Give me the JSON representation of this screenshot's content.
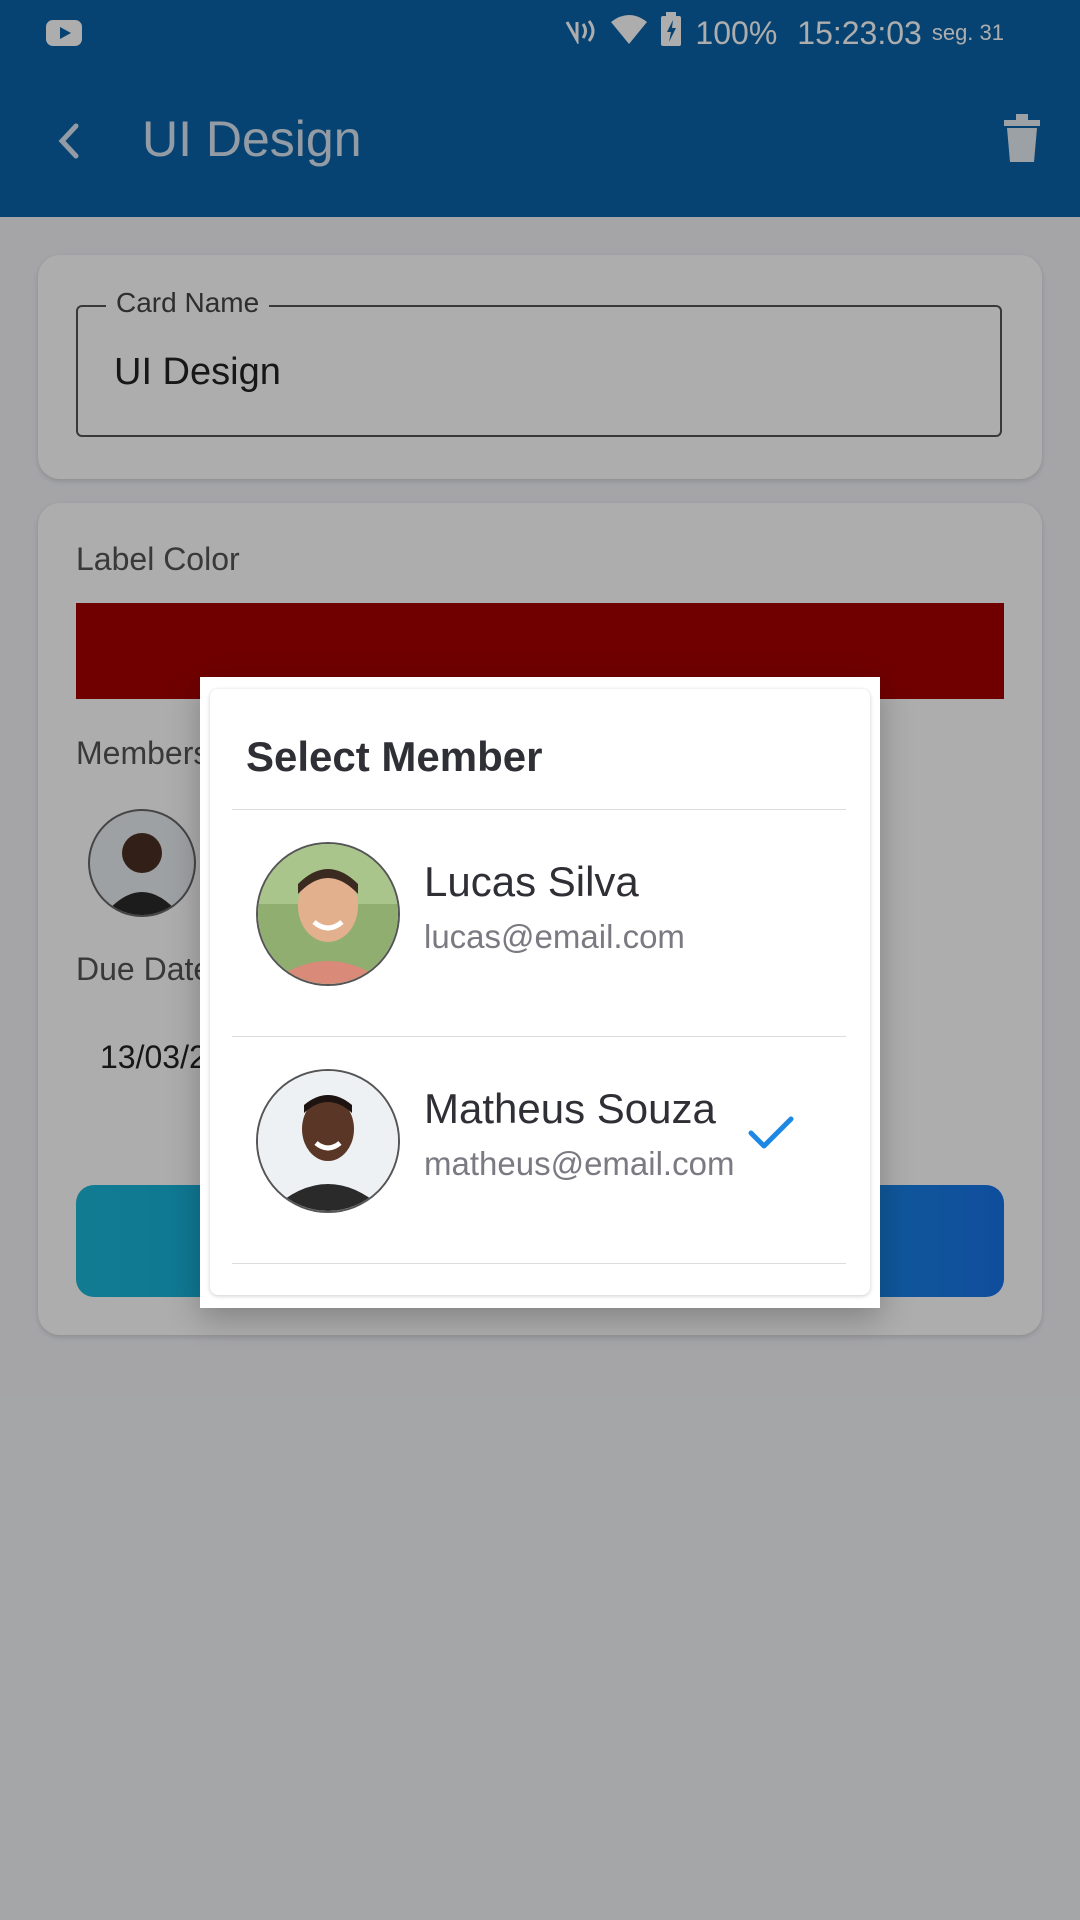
{
  "status_bar": {
    "battery": "100%",
    "time": "15:23:03",
    "date": "seg. 31"
  },
  "app_bar": {
    "title": "UI Design"
  },
  "card_name": {
    "label": "Card Name",
    "value": "UI Design"
  },
  "label_color": {
    "label": "Label Color",
    "color": "#a50000"
  },
  "members": {
    "label": "Members"
  },
  "due_date": {
    "label": "Due Date",
    "value": "13/03/2"
  },
  "dialog": {
    "title": "Select Member",
    "members": [
      {
        "name": "Lucas Silva",
        "email": "lucas@email.com",
        "selected": false
      },
      {
        "name": "Matheus Souza",
        "email": "matheus@email.com",
        "selected": true
      }
    ]
  },
  "colors": {
    "primary": "#0a64a8",
    "check": "#1e88e5"
  }
}
